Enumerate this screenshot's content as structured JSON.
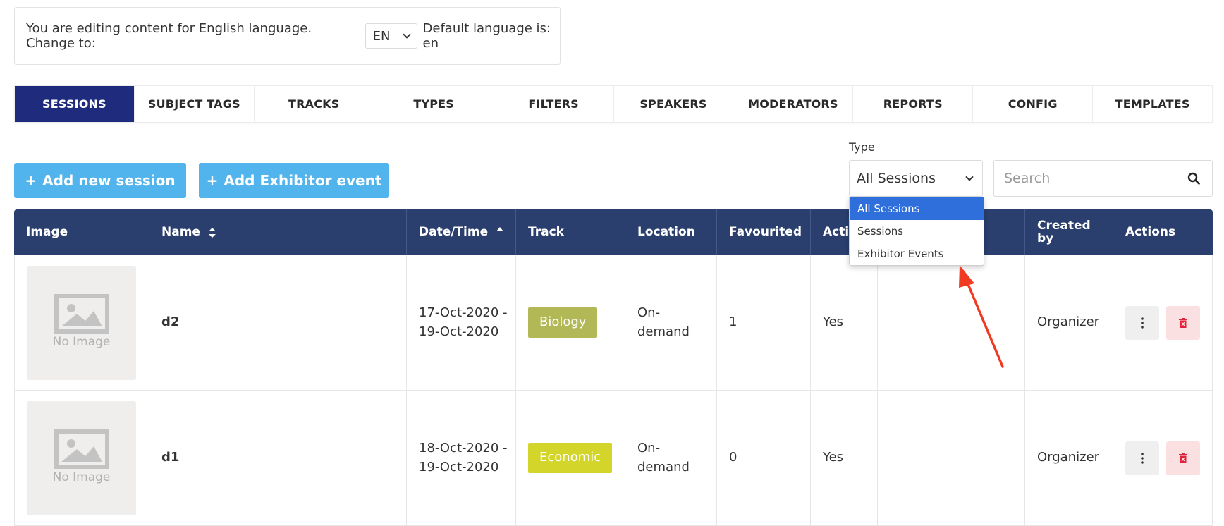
{
  "lang_bar": {
    "prefix": "You are editing content for English language. Change to:",
    "selected": "EN",
    "default_text": "Default language is: en"
  },
  "tabs": [
    {
      "label": "SESSIONS",
      "active": true
    },
    {
      "label": "SUBJECT TAGS"
    },
    {
      "label": "TRACKS"
    },
    {
      "label": "TYPES"
    },
    {
      "label": "FILTERS"
    },
    {
      "label": "SPEAKERS"
    },
    {
      "label": "MODERATORS"
    },
    {
      "label": "REPORTS"
    },
    {
      "label": "CONFIG"
    },
    {
      "label": "TEMPLATES"
    }
  ],
  "buttons": {
    "add_session": "Add new session",
    "add_exhibitor": "Add Exhibitor event"
  },
  "type_filter": {
    "label": "Type",
    "selected": "All Sessions",
    "options": [
      "All Sessions",
      "Sessions",
      "Exhibitor Events"
    ]
  },
  "search": {
    "placeholder": "Search"
  },
  "table": {
    "headers": [
      "Image",
      "Name",
      "Date/Time",
      "Track",
      "Location",
      "Favourited",
      "Activ",
      "",
      "Created by",
      "Actions"
    ],
    "rows": [
      {
        "image": "No Image",
        "name": "d2",
        "date_from": "17-Oct-2020 -",
        "date_to": "19-Oct-2020",
        "track": "Biology",
        "track_color": "#b2b855",
        "location_a": "On-",
        "location_b": "demand",
        "favourited": "1",
        "active": "Yes",
        "created_by": "Organizer"
      },
      {
        "image": "No Image",
        "name": "d1",
        "date_from": "18-Oct-2020 -",
        "date_to": "19-Oct-2020",
        "track": "Economic",
        "track_color": "#d4d52b",
        "location_a": "On-",
        "location_b": "demand",
        "favourited": "0",
        "active": "Yes",
        "created_by": "Organizer"
      }
    ]
  },
  "colors": {
    "active_tab": "#1f2c7e",
    "header_bg": "#2a3f6d",
    "add_button": "#52b4ec",
    "dropdown_selected": "#2e6fdb",
    "annotation_arrow": "#f03a22"
  }
}
